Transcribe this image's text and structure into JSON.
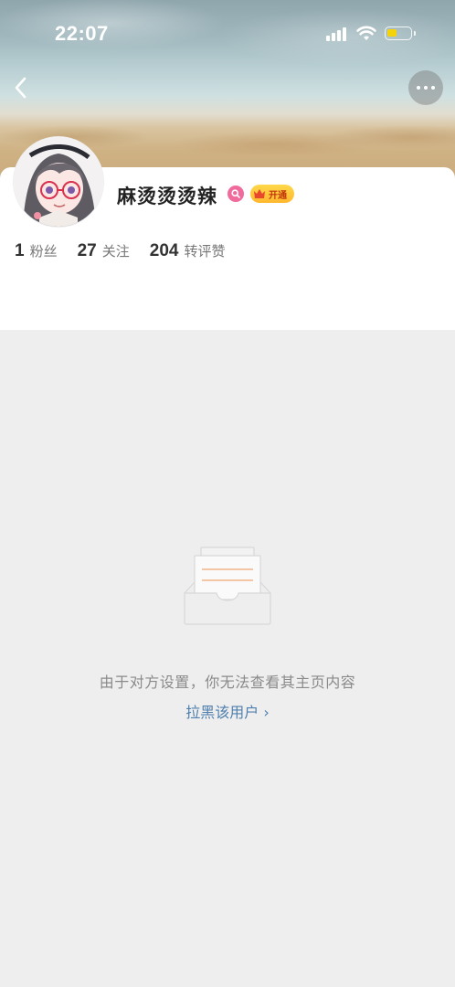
{
  "status_bar": {
    "time": "22:07",
    "icons": [
      "signal-icon",
      "wifi-icon",
      "battery-icon"
    ],
    "battery_color": "#f5d30b"
  },
  "nav": {
    "back_icon": "chevron-left-icon",
    "more_icon": "more-horizontal-icon"
  },
  "profile": {
    "username": "麻烫烫烫辣",
    "badge_icon": "search-badge-icon",
    "vip_label": "开通",
    "stats": [
      {
        "value": "1",
        "label": "粉丝"
      },
      {
        "value": "27",
        "label": "关注"
      },
      {
        "value": "204",
        "label": "转评赞"
      }
    ]
  },
  "empty_state": {
    "icon": "inbox-tray-icon",
    "message": "由于对方设置，你无法查看其主页内容",
    "action_label": "拉黑该用户 ›"
  },
  "colors": {
    "background": "#eeeeee",
    "link": "#4f7fae",
    "vip": "#ffc83a",
    "badge": "#f06b9c"
  }
}
